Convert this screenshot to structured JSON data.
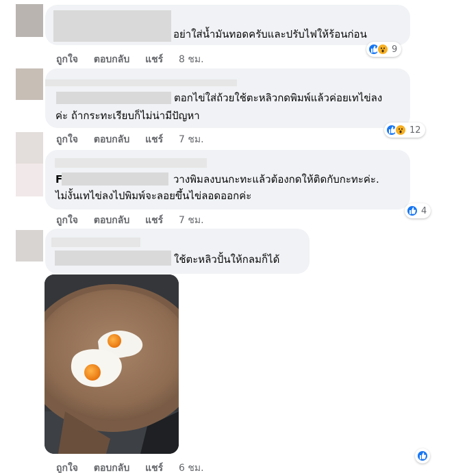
{
  "comments": [
    {
      "text": "อย่าใส่น้ำมันทอดครับและปรับไฟให้ร้อนก่อน",
      "actions": {
        "like": "ถูกใจ",
        "reply": "ตอบกลับ",
        "share": "แชร์",
        "time": "8 ชม."
      },
      "reactions": {
        "icons": [
          "like-icon",
          "wow-icon"
        ],
        "count": "9"
      }
    },
    {
      "text_line1": "ตอกไข่ใส่ถ้วยใช้ตะหลิวกดพิมพ์แล้วค่อยเทไข่ลง",
      "text_line2": "ค่ะ ถ้ากระทะเรียบก็ไม่น่ามีปัญหา",
      "actions": {
        "like": "ถูกใจ",
        "reply": "ตอบกลับ",
        "share": "แชร์",
        "time": "7 ชม."
      },
      "reactions": {
        "icons": [
          "like-icon",
          "wow-icon"
        ],
        "count": "12"
      }
    },
    {
      "name_initial": "F",
      "text_line1": "วางพิมลงบนกะทะแล้วต้องกดให้ติดกับกะทะค่ะ.",
      "text_line2": "ไม่งั้นเทไข่ลงไปพิมพ์จะลอยขึ้นไข่ลอดออกค่ะ",
      "actions": {
        "like": "ถูกใจ",
        "reply": "ตอบกลับ",
        "share": "แชร์",
        "time": "7 ชม."
      },
      "reactions": {
        "icons": [
          "like-icon"
        ],
        "count": "4"
      }
    },
    {
      "text": "ใช้ตะหลิวปั้นให้กลมก็ได้",
      "photo": "fried-eggs-in-pan",
      "actions": {
        "like": "ถูกใจ",
        "reply": "ตอบกลับ",
        "share": "แชร์",
        "time": "6 ชม."
      },
      "reactions": {
        "icons": [
          "like-icon"
        ],
        "count": ""
      }
    }
  ],
  "colors": {
    "bubble": "#f0f2f5",
    "like": "#1877f2",
    "wow": "#f7b125",
    "meta": "#65676b"
  }
}
